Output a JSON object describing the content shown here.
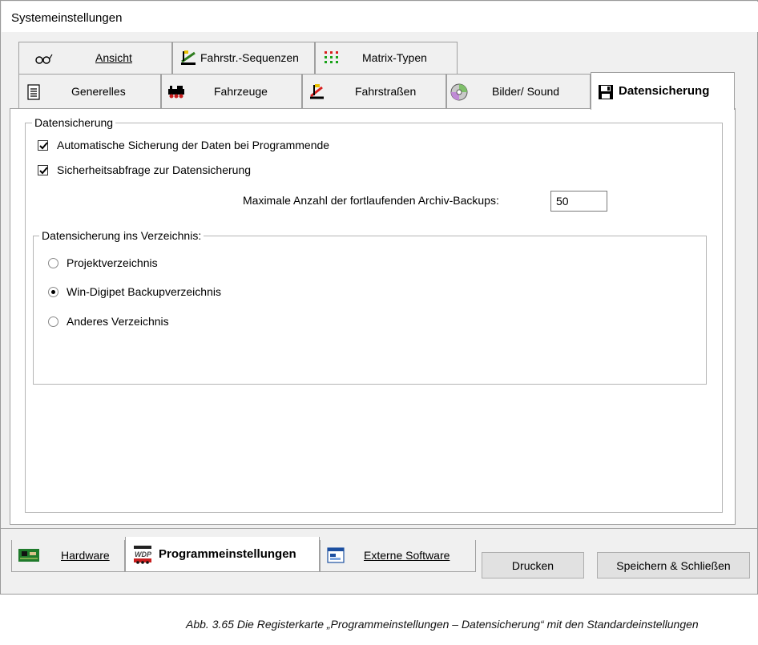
{
  "window": {
    "title": "Systemeinstellungen"
  },
  "top_tabs_row1": [
    {
      "label": "Ansicht",
      "icon": "glasses-icon"
    },
    {
      "label": "Fahrstr.-Sequenzen",
      "icon": "route-sequence-icon"
    },
    {
      "label": "Matrix-Typen",
      "icon": "matrix-grid-icon"
    }
  ],
  "top_tabs_row2": [
    {
      "label": "Generelles",
      "icon": "document-icon"
    },
    {
      "label": "Fahrzeuge",
      "icon": "locomotive-icon"
    },
    {
      "label": "Fahrstraßen",
      "icon": "route-icon"
    },
    {
      "label": "Bilder/ Sound",
      "icon": "cd-icon"
    },
    {
      "label": "Datensicherung",
      "icon": "floppy-disk-icon",
      "active": true
    }
  ],
  "datensicherung": {
    "group_label": "Datensicherung",
    "auto_backup": {
      "label": "Automatische Sicherung der Daten bei Programmende",
      "checked": true
    },
    "confirm_backup": {
      "label": "Sicherheitsabfrage zur Datensicherung",
      "checked": true
    },
    "max_backups": {
      "label": "Maximale Anzahl der fortlaufenden Archiv-Backups:",
      "value": "50"
    }
  },
  "directory": {
    "group_label": "Datensicherung ins Verzeichnis:",
    "options": [
      {
        "label": "Projektverzeichnis",
        "selected": false
      },
      {
        "label": "Win-Digipet Backupverzeichnis",
        "selected": true
      },
      {
        "label": "Anderes Verzeichnis",
        "selected": false
      }
    ]
  },
  "bottom_tabs": [
    {
      "label": "Hardware",
      "icon": "circuit-board-icon"
    },
    {
      "label": "Programmeinstellungen",
      "icon": "wdp-logo-icon",
      "active": true
    },
    {
      "label": "Externe Software",
      "icon": "window-app-icon"
    }
  ],
  "buttons": {
    "print": "Drucken",
    "save_close": "Speichern & Schließen"
  },
  "caption": "Abb. 3.65    Die Registerkarte „Programmeinstellungen – Datensicherung“ mit den Standardeinstellungen",
  "colors": {
    "window_bg": "#f0f0f0",
    "panel_bg": "#ffffff",
    "border": "#a0a0a0"
  }
}
